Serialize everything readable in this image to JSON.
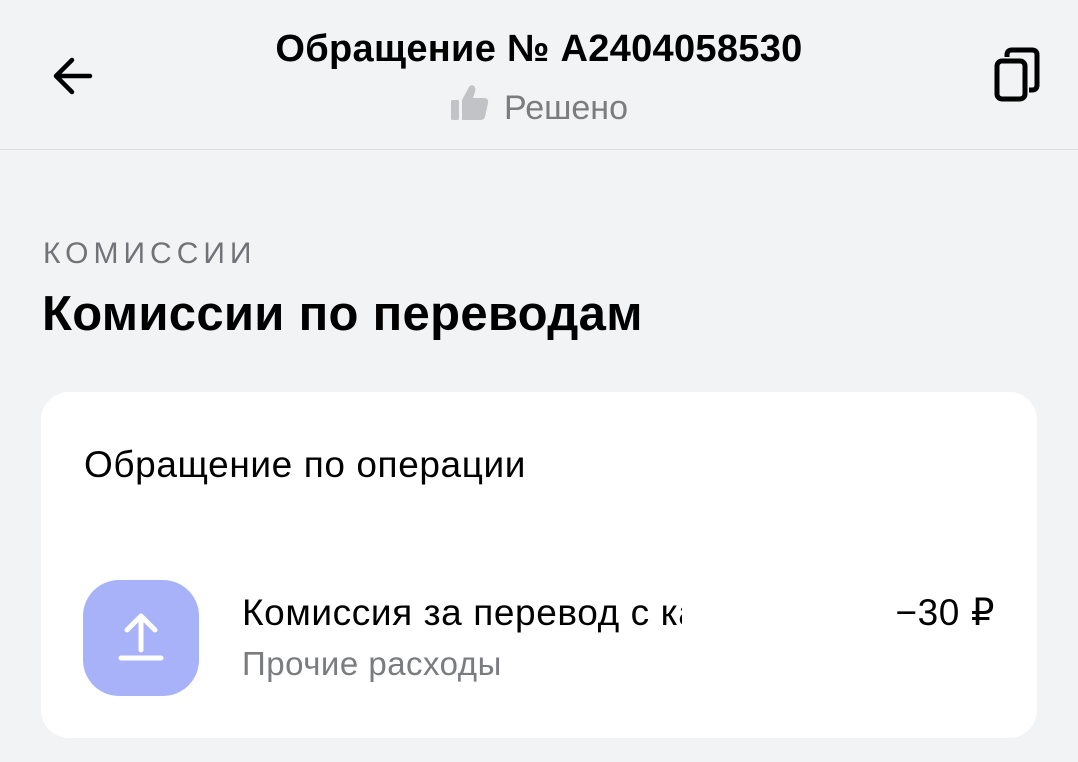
{
  "header": {
    "back_icon": "arrow-left-icon",
    "title": "Обращение № A2404058530",
    "status_icon": "thumbs-up-icon",
    "status": "Решено",
    "copy_icon": "copy-icon"
  },
  "category": "КОМИССИИ",
  "heading": "Комиссии по переводам",
  "card": {
    "title": "Обращение по операции",
    "operation": {
      "icon": "upload-arrow-icon",
      "icon_color": "#a8b2f9",
      "name": "Комиссия за перевод с карт…",
      "category": "Прочие расходы",
      "amount": "−30 ₽"
    }
  }
}
